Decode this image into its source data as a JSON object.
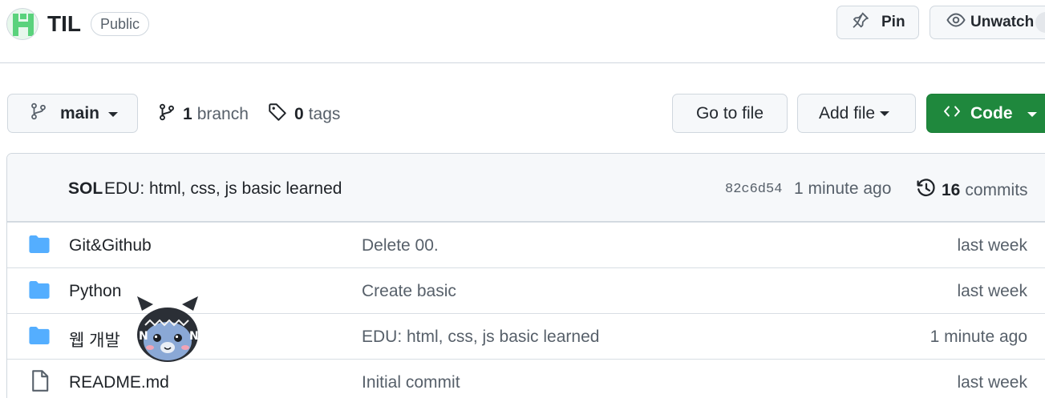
{
  "repo": {
    "name": "TIL",
    "visibility": "Public"
  },
  "header_actions": {
    "pin_label": "Pin",
    "unwatch_label": "Unwatch"
  },
  "toolbar": {
    "branch_name": "main",
    "branch_count": "1",
    "branch_label": "branch",
    "tag_count": "0",
    "tag_label": "tags",
    "goto_file_label": "Go to file",
    "add_file_label": "Add file",
    "code_label": "Code"
  },
  "latest_commit": {
    "author": "SOL",
    "message": "EDU: html, css, js basic learned",
    "sha": "82c6d54",
    "time": "1 minute ago",
    "commit_count": "16",
    "commits_label": "commits"
  },
  "files": [
    {
      "type": "folder",
      "name": "Git&Github",
      "commit": "Delete 00.",
      "time": "last week"
    },
    {
      "type": "folder",
      "name": "Python",
      "commit": "Create basic",
      "time": "last week"
    },
    {
      "type": "folder",
      "name": "웹 개발",
      "commit": "EDU: html, css, js basic learned",
      "time": "1 minute ago"
    },
    {
      "type": "file",
      "name": "README.md",
      "commit": "Initial commit",
      "time": "last week"
    }
  ],
  "colors": {
    "code_button": "#1f883d",
    "folder_icon": "#54aeff",
    "border": "#d0d7de"
  }
}
